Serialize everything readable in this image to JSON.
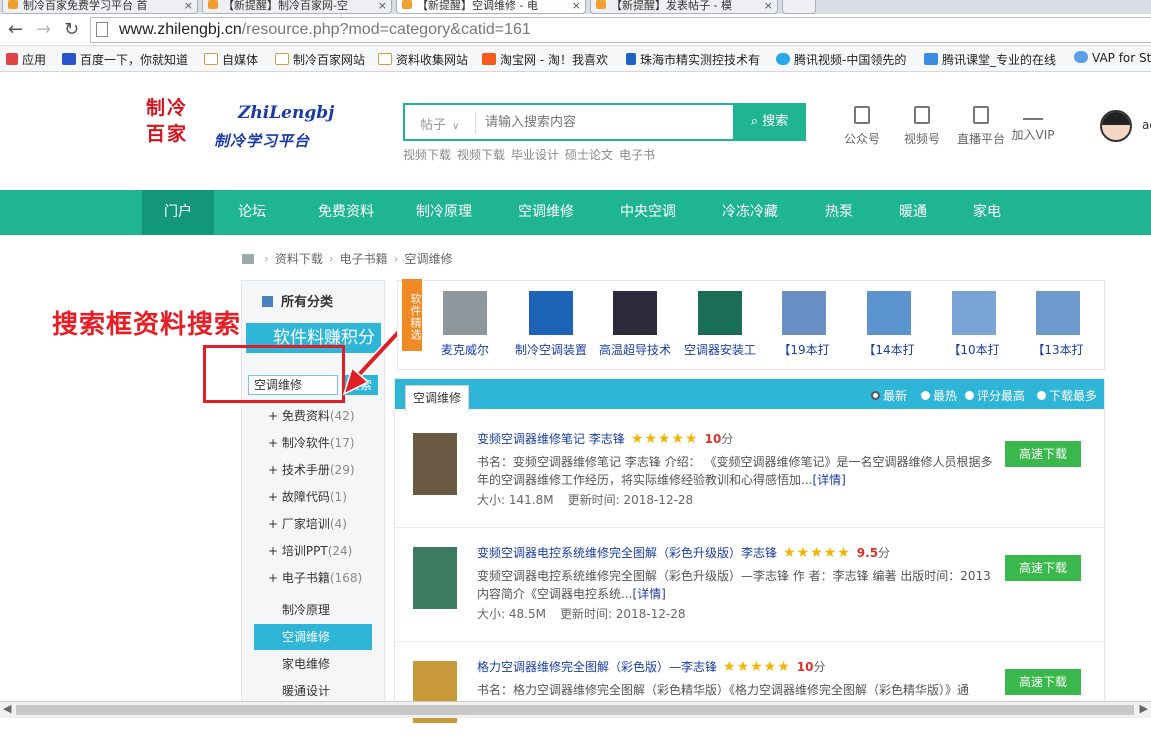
{
  "browser": {
    "tabs": [
      {
        "label": "制冷百家免费学习平台 首"
      },
      {
        "label": "【新提醒】制冷百家网-空"
      },
      {
        "label": "【新提醒】空调维修 - 电"
      },
      {
        "label": "【新提醒】发表帖子 - 模"
      }
    ],
    "url_host": "www.zhilengbj.cn",
    "url_path": "/resource.php?mod=category&catid=161",
    "bookmarks": [
      {
        "label": "应用"
      },
      {
        "label": "百度一下，你就知道"
      },
      {
        "label": "自媒体"
      },
      {
        "label": "制冷百家网站"
      },
      {
        "label": "资料收集网站"
      },
      {
        "label": "淘宝网 - 淘！我喜欢"
      },
      {
        "label": "珠海市精实测控技术有"
      },
      {
        "label": "腾讯视频-中国领先的"
      },
      {
        "label": "腾讯课堂_专业的在线"
      },
      {
        "label": "VAP for St"
      }
    ]
  },
  "header": {
    "logo_cn": "制冷百家",
    "logo_py": "ZhiLengbj",
    "logo_slogan": "制冷学习平台",
    "search_type": "帖子",
    "search_placeholder": "请输入搜索内容",
    "search_button": "搜索",
    "hot_links": [
      "视频下载",
      "视频下载",
      "毕业设计",
      "硕士论文",
      "电子书"
    ],
    "icons": [
      {
        "label": "公众号"
      },
      {
        "label": "视频号"
      },
      {
        "label": "直播平台"
      },
      {
        "label": "加入VIP"
      }
    ],
    "user_name": "ad"
  },
  "nav": [
    "门户",
    "论坛",
    "免费资料",
    "制冷原理",
    "空调维修",
    "中央空调",
    "冷冻冷藏",
    "热泵",
    "暖通",
    "家电"
  ],
  "breadcrumb": [
    "资料下载",
    "电子书籍",
    "空调维修"
  ],
  "sidebar": {
    "all_categories": "所有分类",
    "header": "软件料赚积分",
    "search_value": "空调维修",
    "search_button": "搜索",
    "categories": [
      {
        "label": "+ 免费资料",
        "count": "(42)"
      },
      {
        "label": "+ 制冷软件",
        "count": "(17)"
      },
      {
        "label": "+ 技术手册",
        "count": "(29)"
      },
      {
        "label": "+ 故障代码",
        "count": "(1)"
      },
      {
        "label": "+ 厂家培训",
        "count": "(4)"
      },
      {
        "label": "+ 培训PPT",
        "count": "(24)"
      },
      {
        "label": "+ 电子书籍",
        "count": "(168)"
      }
    ],
    "subcategories": [
      "制冷原理",
      "空调维修",
      "家电维修",
      "暖通设计"
    ]
  },
  "annotation": "搜索框资料搜索",
  "featured": {
    "badge": "软件精选",
    "items": [
      "麦克威尔",
      "制冷空调装置",
      "高温超导技术",
      "空调器安装工",
      "【19本打",
      "【14本打",
      "【10本打",
      "【13本打"
    ]
  },
  "list": {
    "tab": "空调维修",
    "sorts": [
      "最新",
      "最热",
      "评分最高",
      "下载最多"
    ],
    "items": [
      {
        "title": "变频空调器维修笔记 李志锋",
        "stars": "★★★★★",
        "score": "10",
        "score_unit": "分",
        "desc": "书名：变频空调器维修笔记 李志锋 介绍：    《变频空调器维修笔记》是一名空调器维修人员根据多年的空调器维修工作经历，将实际维修经验教训和心得感悟加...",
        "more": "[详情]",
        "size": "大小: 141.8M",
        "updated": "更新时间: 2018-12-28",
        "download": "高速下载"
      },
      {
        "title": "变频空调器电控系统维修完全图解（彩色升级版）李志锋",
        "stars": "★★★★★",
        "score": "9.5",
        "score_unit": "分",
        "desc": "变频空调器电控系统维修完全图解（彩色升级版）—李志锋 作  者：李志锋 编著 出版时间：2013 内容简介《空调器电控系统...",
        "more": "[详情]",
        "size": "大小: 48.5M",
        "updated": "更新时间: 2018-12-28",
        "download": "高速下载"
      },
      {
        "title": "格力空调器维修完全图解（彩色版）—李志锋",
        "stars": "★★★★★",
        "score": "10",
        "score_unit": "分",
        "desc": "书名：格力空调器维修完全图解（彩色精华版）《格力空调器维修完全图解（彩色精华版）》通",
        "more": "",
        "size": "",
        "updated": "",
        "download": "高速下载"
      }
    ]
  },
  "colors": {
    "brand": "#1fb592",
    "accent": "#2fb5d8",
    "annotation": "#e01e25",
    "download": "#3ab84c"
  }
}
